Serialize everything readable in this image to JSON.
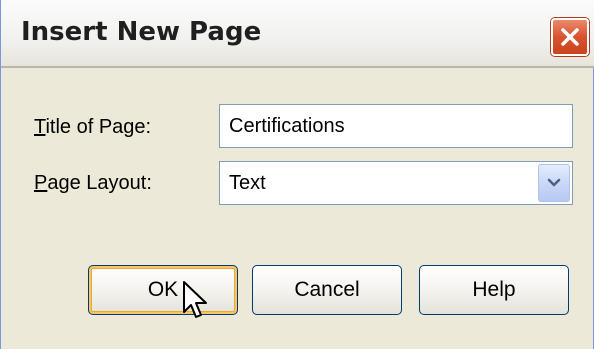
{
  "window": {
    "title": "Insert New Page",
    "close_icon": "close-icon"
  },
  "form": {
    "title_label_mnemonic": "T",
    "title_label_rest": "itle of Page:",
    "title_value": "Certifications",
    "layout_label_mnemonic": "P",
    "layout_label_rest": "age Layout:",
    "layout_value": "Text",
    "layout_dropdown_icon": "chevron-down-icon"
  },
  "buttons": {
    "ok_label": "OK",
    "cancel_label": "Cancel",
    "help_label": "Help"
  },
  "colors": {
    "dialog_bg": "#ece9d8",
    "close_button": "#d9532f",
    "field_border": "#7f9db9",
    "default_button_highlight": "#f7c565"
  },
  "cursor_icon": "mouse-pointer-icon"
}
